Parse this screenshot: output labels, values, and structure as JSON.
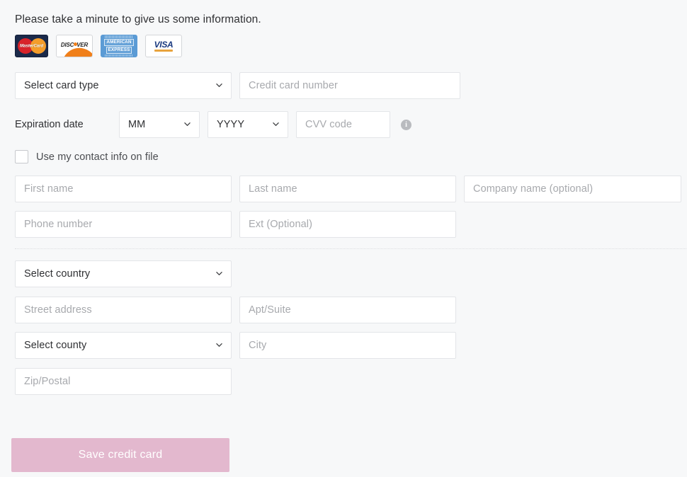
{
  "page": {
    "intro": "Please take a minute to give us some information.",
    "background_color": "#f7f8f9"
  },
  "card_logos": [
    {
      "name": "mastercard",
      "label": "MasterCard"
    },
    {
      "name": "discover",
      "label_left": "DISC",
      "label_right": "VER"
    },
    {
      "name": "amex",
      "line1": "AMERICAN",
      "line2": "EXPRESS"
    },
    {
      "name": "visa",
      "label": "VISA"
    }
  ],
  "payment": {
    "card_type_select": {
      "value": "Select card type",
      "options": [
        "Select card type"
      ]
    },
    "card_number": {
      "value": "",
      "placeholder": "Credit card number"
    },
    "expiration_label": "Expiration date",
    "month_select": {
      "value": "MM",
      "options": [
        "MM"
      ]
    },
    "year_select": {
      "value": "YYYY",
      "options": [
        "YYYY"
      ]
    },
    "cvv": {
      "value": "",
      "placeholder": "CVV code"
    },
    "cvv_info_glyph": "i"
  },
  "contact": {
    "use_contact_info_checkbox": {
      "label": "Use my contact info on file",
      "checked": false
    },
    "first_name": {
      "value": "",
      "placeholder": "First name"
    },
    "last_name": {
      "value": "",
      "placeholder": "Last name"
    },
    "company_name": {
      "value": "",
      "placeholder": "Company name (optional)"
    },
    "phone_number": {
      "value": "",
      "placeholder": "Phone number"
    },
    "ext": {
      "value": "",
      "placeholder": "Ext (Optional)"
    }
  },
  "address": {
    "country_select": {
      "value": "Select country",
      "options": [
        "Select country"
      ]
    },
    "street_address": {
      "value": "",
      "placeholder": "Street address"
    },
    "apt_suite": {
      "value": "",
      "placeholder": "Apt/Suite"
    },
    "county_select": {
      "value": "Select county",
      "options": [
        "Select county"
      ]
    },
    "city": {
      "value": "",
      "placeholder": "City"
    },
    "zip_postal": {
      "value": "",
      "placeholder": "Zip/Postal"
    }
  },
  "actions": {
    "save_label": "Save credit card",
    "save_color": "#e3b8ce"
  }
}
